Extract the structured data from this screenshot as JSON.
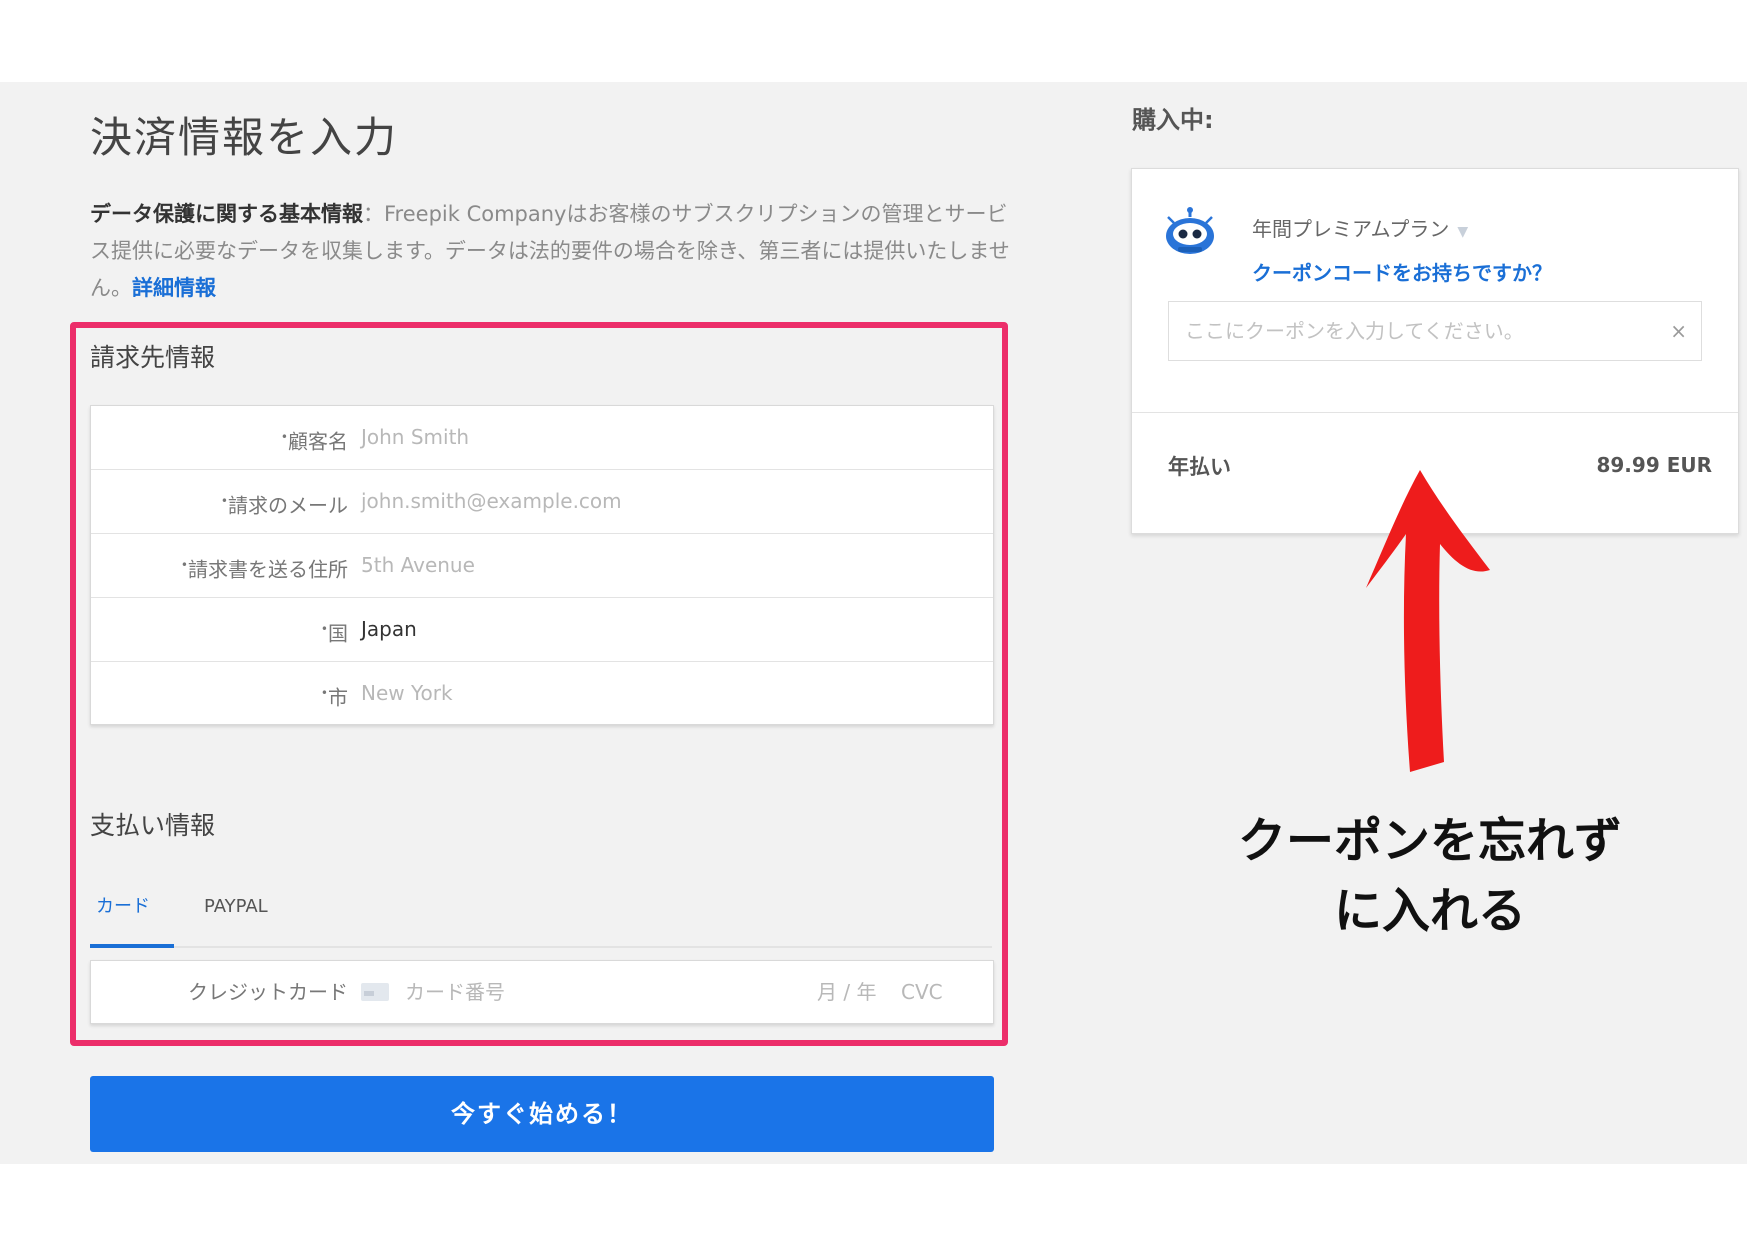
{
  "page_title": "決済情報を入力",
  "notice": {
    "heading": "データ保護に関する基本情報",
    "separator": "：",
    "body": "Freepik Companyはお客様のサブスクリプションの管理とサービス提供に必要なデータを収集します。データは法的要件の場合を除き、第三者には提供いたしません。",
    "link": "詳細情報"
  },
  "billing": {
    "heading": "請求先情報",
    "fields": [
      {
        "label": "顧客名",
        "value": "John Smith",
        "filled": false
      },
      {
        "label": "請求のメール",
        "value": "john.smith@example.com",
        "filled": false
      },
      {
        "label": "請求書を送る住所",
        "value": "5th Avenue",
        "filled": false
      },
      {
        "label": "国",
        "value": "Japan",
        "filled": true
      },
      {
        "label": "市",
        "value": "New York",
        "filled": false
      }
    ]
  },
  "payment": {
    "heading": "支払い情報",
    "tabs": [
      {
        "label": "カード",
        "active": true
      },
      {
        "label": "PAYPAL",
        "active": false
      }
    ],
    "card_field": {
      "label": "クレジットカード",
      "number_placeholder": "カード番号",
      "expiry_placeholder": "月 / 年",
      "cvc_placeholder": "CVC"
    }
  },
  "submit_label": "今すぐ始める！",
  "summary": {
    "heading": "購入中:",
    "plan_name": "年間プレミアムプラン",
    "coupon_link": "クーポンコードをお持ちですか？",
    "coupon_placeholder": "ここにクーポンを入力してください。",
    "clear_symbol": "×",
    "billing_period": "年払い",
    "price": "89.99 EUR"
  },
  "annotation": {
    "line1": "クーポンを忘れず",
    "line2": "に入れる"
  },
  "colors": {
    "accent_blue": "#1a74e8",
    "highlight_pink": "#ec2e6a",
    "arrow_red": "#ee1c1c",
    "background_gray": "#f2f2f2"
  }
}
